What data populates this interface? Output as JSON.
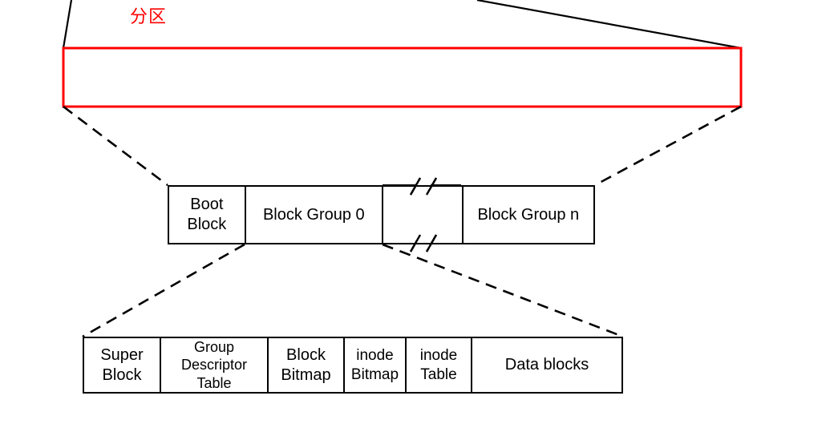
{
  "diagram": {
    "title_label": "分区",
    "title_color": "#ff0000",
    "partition_bar": {
      "name_label": "分区",
      "border_color": "#ff0000"
    },
    "middle_row": {
      "cells": [
        {
          "label": "Boot\nBlock"
        },
        {
          "label": "Block Group 0"
        },
        {
          "label": ""
        },
        {
          "label": ""
        },
        {
          "label": "Block Group n"
        }
      ],
      "break_symbol": "//"
    },
    "bottom_row": {
      "cells": [
        {
          "label": "Super\nBlock"
        },
        {
          "label": "Group\nDescriptor\nTable"
        },
        {
          "label": "Block\nBitmap"
        },
        {
          "label": "inode\nBitmap"
        },
        {
          "label": "inode\nTable"
        },
        {
          "label": "Data blocks"
        }
      ]
    },
    "colors": {
      "stroke": "#000000",
      "partition": "#ff0000",
      "background": "#ffffff"
    }
  }
}
